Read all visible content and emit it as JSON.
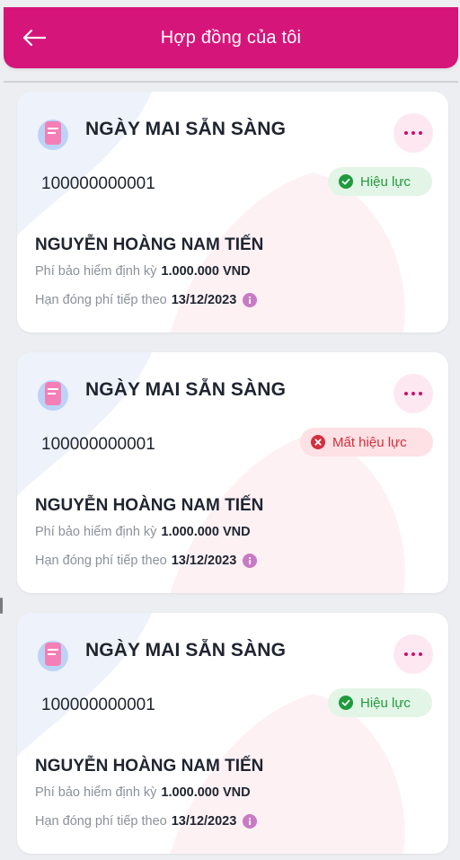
{
  "header": {
    "title": "Hợp đồng của tôi",
    "back_icon": "arrow-left-icon",
    "color": "#d6157a"
  },
  "contracts": [
    {
      "product": "NGÀY MAI SẴN SÀNG",
      "number": "100000000001",
      "status": "Hiệu lực",
      "status_type": "active",
      "holder": "NGUYỄN HOÀNG NAM TIẾN",
      "premium_label": "Phí bảo hiểm định kỳ",
      "premium_value": "1.000.000 VND",
      "due_label": "Hạn đóng phí tiếp theo",
      "due_value": "13/12/2023"
    },
    {
      "product": "NGÀY MAI SẴN SÀNG",
      "number": "100000000001",
      "status": "Mất hiệu lực",
      "status_type": "inactive",
      "holder": "NGUYỄN HOÀNG NAM TIẾN",
      "premium_label": "Phí bảo hiểm định kỳ",
      "premium_value": "1.000.000 VND",
      "due_label": "Hạn đóng phí tiếp theo",
      "due_value": "13/12/2023"
    },
    {
      "product": "NGÀY MAI SẴN SÀNG",
      "number": "100000000001",
      "status": "Hiệu lực",
      "status_type": "active",
      "holder": "NGUYỄN HOÀNG NAM TIẾN",
      "premium_label": "Phí bảo hiểm định kỳ",
      "premium_value": "1.000.000 VND",
      "due_label": "Hạn đóng phí tiếp theo",
      "due_value": "13/12/2023"
    }
  ],
  "colors": {
    "active_bg": "#e3f5e6",
    "active_text": "#1f9a3c",
    "inactive_bg": "#fde1e4",
    "inactive_text": "#d32f3c",
    "accent": "#c8106f"
  }
}
